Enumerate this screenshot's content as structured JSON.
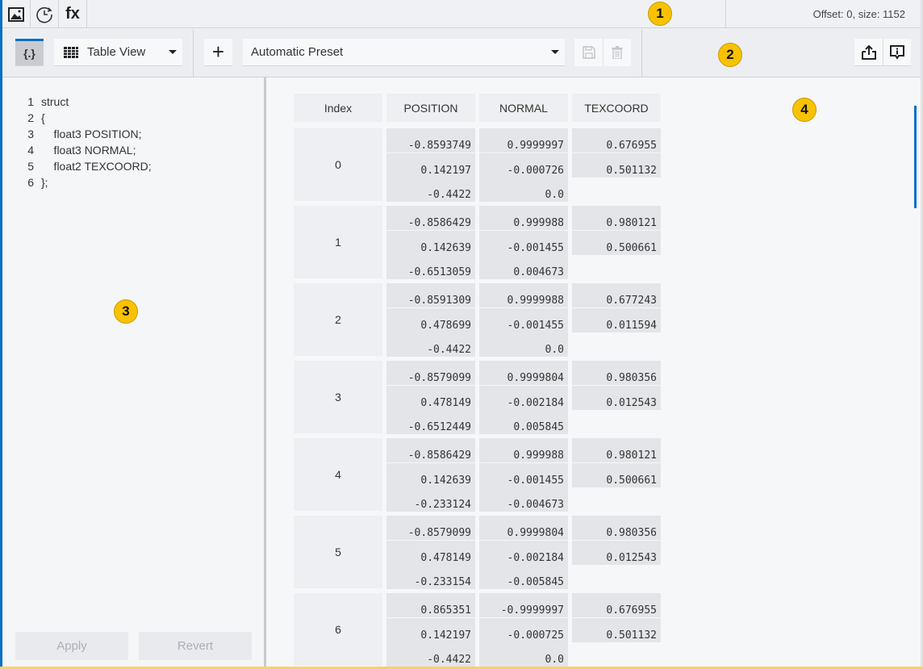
{
  "topbar": {
    "icons": [
      "image-icon",
      "history-icon",
      "function-icon"
    ],
    "fx_label": "fx",
    "offset_text": "Offset: 0, size: 1152"
  },
  "toolbar": {
    "struct_toggle": "{.}",
    "view_select": "Table View",
    "add": "+",
    "preset_select": "Automatic Preset"
  },
  "editor": {
    "lines": [
      {
        "n": "1",
        "text": "struct"
      },
      {
        "n": "2",
        "text": "{"
      },
      {
        "n": "3",
        "text": "    float3 POSITION;"
      },
      {
        "n": "4",
        "text": "    float3 NORMAL;"
      },
      {
        "n": "5",
        "text": "    float2 TEXCOORD;"
      },
      {
        "n": "6",
        "text": "};"
      }
    ],
    "apply": "Apply",
    "revert": "Revert"
  },
  "table": {
    "headers": [
      "Index",
      "POSITION",
      "NORMAL",
      "TEXCOORD"
    ],
    "rows": [
      {
        "index": "0",
        "position": [
          "-0.8593749",
          "0.142197",
          "-0.4422"
        ],
        "normal": [
          "0.9999997",
          "-0.000726",
          "0.0"
        ],
        "texcoord": [
          "0.676955",
          "0.501132"
        ]
      },
      {
        "index": "1",
        "position": [
          "-0.8586429",
          "0.142639",
          "-0.6513059"
        ],
        "normal": [
          "0.999988",
          "-0.001455",
          "0.004673"
        ],
        "texcoord": [
          "0.980121",
          "0.500661"
        ]
      },
      {
        "index": "2",
        "position": [
          "-0.8591309",
          "0.478699",
          "-0.4422"
        ],
        "normal": [
          "0.9999988",
          "-0.001455",
          "0.0"
        ],
        "texcoord": [
          "0.677243",
          "0.011594"
        ]
      },
      {
        "index": "3",
        "position": [
          "-0.8579099",
          "0.478149",
          "-0.6512449"
        ],
        "normal": [
          "0.9999804",
          "-0.002184",
          "0.005845"
        ],
        "texcoord": [
          "0.980356",
          "0.012543"
        ]
      },
      {
        "index": "4",
        "position": [
          "-0.8586429",
          "0.142639",
          "-0.233124"
        ],
        "normal": [
          "0.999988",
          "-0.001455",
          "-0.004673"
        ],
        "texcoord": [
          "0.980121",
          "0.500661"
        ]
      },
      {
        "index": "5",
        "position": [
          "-0.8579099",
          "0.478149",
          "-0.233154"
        ],
        "normal": [
          "0.9999804",
          "-0.002184",
          "-0.005845"
        ],
        "texcoord": [
          "0.980356",
          "0.012543"
        ]
      },
      {
        "index": "6",
        "position": [
          "0.865351",
          "0.142197",
          "-0.4422"
        ],
        "normal": [
          "-0.9999997",
          "-0.000725",
          "0.0"
        ],
        "texcoord": [
          "0.676955",
          "0.501132"
        ]
      }
    ]
  },
  "badges": [
    "1",
    "2",
    "3",
    "4"
  ],
  "colors": {
    "accent": "#0a6fc2",
    "badge": "#f8c200"
  }
}
